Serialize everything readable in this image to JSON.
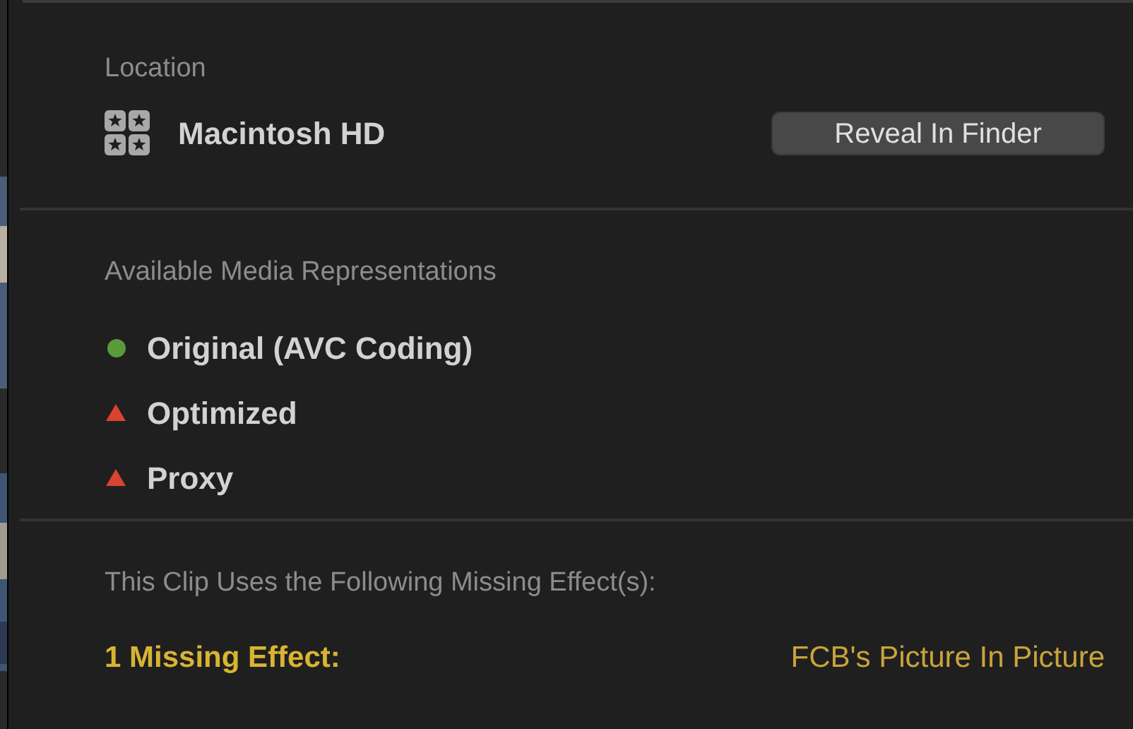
{
  "location": {
    "heading": "Location",
    "volume": "Macintosh HD",
    "button": "Reveal In Finder"
  },
  "media": {
    "heading": "Available Media Representations",
    "items": [
      {
        "label": "Original (AVC Coding)",
        "kind": "available"
      },
      {
        "label": "Optimized",
        "kind": "missing"
      },
      {
        "label": "Proxy",
        "kind": "missing"
      }
    ]
  },
  "effects": {
    "heading": "This Clip Uses the Following Missing Effect(s):",
    "count": "1 Missing Effect:",
    "name": "FCB's Picture In Picture"
  }
}
